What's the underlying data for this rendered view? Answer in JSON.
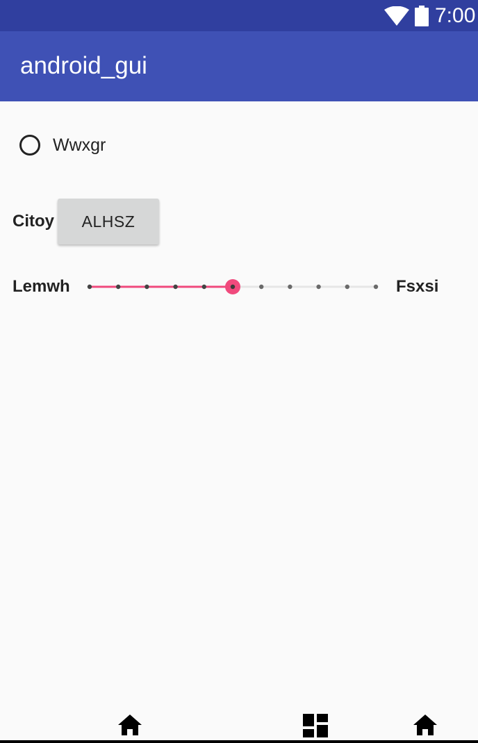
{
  "status_bar": {
    "time": "7:00",
    "icons": [
      "wifi-icon",
      "battery-icon"
    ],
    "background": "#303f9f"
  },
  "app_bar": {
    "title": "android_gui",
    "background": "#3f51b5"
  },
  "radio": {
    "label": "Wwxgr",
    "checked": false
  },
  "button_row": {
    "label": "Citoy",
    "button_label": "ALHSZ"
  },
  "slider_row": {
    "left_label": "Lemwh",
    "right_label": "Fsxsi",
    "steps": 10,
    "value": 5,
    "accent": "#f04a7d"
  },
  "nav_bar": {
    "icons": [
      "home-icon",
      "dashboard-icon",
      "home-icon"
    ]
  }
}
